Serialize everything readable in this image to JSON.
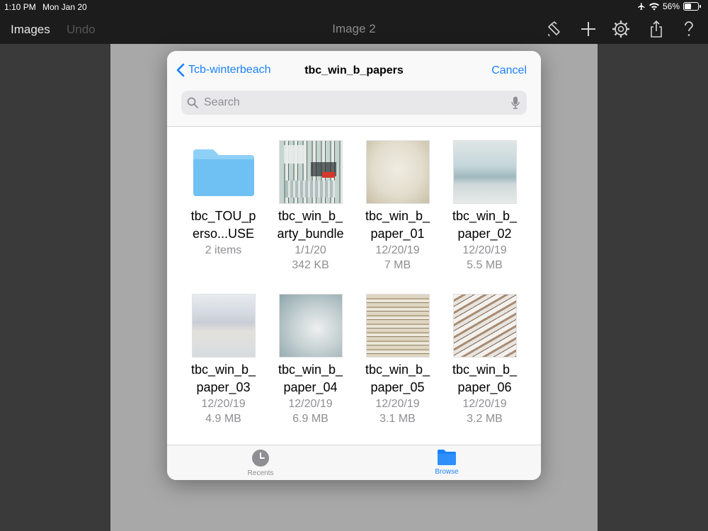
{
  "status_bar": {
    "time": "1:10 PM",
    "date": "Mon Jan 20",
    "battery": "56%",
    "battery_level": 0.56
  },
  "toolbar": {
    "images_label": "Images",
    "undo_label": "Undo",
    "title": "Image 2"
  },
  "picker": {
    "back_label": "Tcb-winterbeach",
    "title": "tbc_win_b_papers",
    "cancel_label": "Cancel",
    "search_placeholder": "Search"
  },
  "files": [
    {
      "line1": "tbc_TOU_p",
      "line2": "erso...USE",
      "meta1": "2 items",
      "meta2": "",
      "kind": "folder"
    },
    {
      "line1": "tbc_win_b_",
      "line2": "arty_bundle",
      "meta1": "1/1/20",
      "meta2": "342 KB",
      "kind": "bundle"
    },
    {
      "line1": "tbc_win_b_",
      "line2": "paper_01",
      "meta1": "12/20/19",
      "meta2": "7 MB",
      "kind": "paper"
    },
    {
      "line1": "tbc_win_b_",
      "line2": "paper_02",
      "meta1": "12/20/19",
      "meta2": "5.5 MB",
      "kind": "paper"
    },
    {
      "line1": "tbc_win_b_",
      "line2": "paper_03",
      "meta1": "12/20/19",
      "meta2": "4.9 MB",
      "kind": "paper"
    },
    {
      "line1": "tbc_win_b_",
      "line2": "paper_04",
      "meta1": "12/20/19",
      "meta2": "6.9 MB",
      "kind": "paper"
    },
    {
      "line1": "tbc_win_b_",
      "line2": "paper_05",
      "meta1": "12/20/19",
      "meta2": "3.1 MB",
      "kind": "paper"
    },
    {
      "line1": "tbc_win_b_",
      "line2": "paper_06",
      "meta1": "12/20/19",
      "meta2": "3.2 MB",
      "kind": "paper"
    }
  ],
  "tabs": {
    "recents_label": "Recents",
    "browse_label": "Browse"
  },
  "colors": {
    "accent": "#1a82fb",
    "folder": "#7fc6f5",
    "toolbar_bg": "#1c1c1c"
  },
  "icons": [
    "airplane-icon",
    "wifi-icon",
    "battery-icon",
    "brush-icon",
    "plus-icon",
    "gear-icon",
    "share-icon",
    "help-icon",
    "chevron-left-icon",
    "search-icon",
    "microphone-icon",
    "folder-icon",
    "clock-icon",
    "browse-folder-icon"
  ]
}
